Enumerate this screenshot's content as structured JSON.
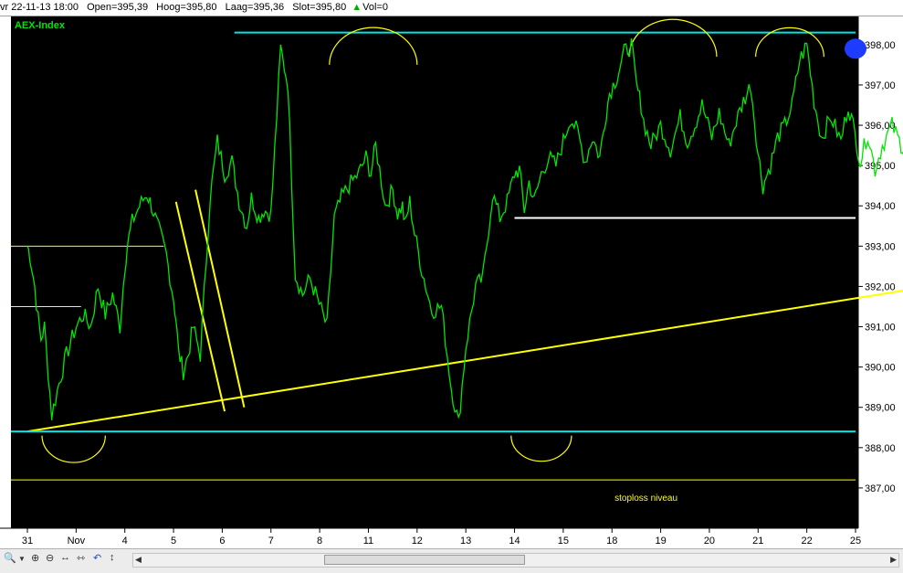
{
  "info": {
    "datetime": "vr 22-11-13 18:00",
    "open": "Open=395,39",
    "high": "Hoog=395,80",
    "low": "Laag=395,36",
    "close": "Slot=395,80",
    "vol_icon": "triangle-up-icon",
    "vol": "Vol=0"
  },
  "chart_data": {
    "type": "line",
    "title": "AEX-Index",
    "annotation": "stoploss niveau",
    "ylim": [
      386.0,
      398.7
    ],
    "y_ticks": [
      "398,00",
      "397,00",
      "396,00",
      "395,00",
      "394,00",
      "393,00",
      "392,00",
      "391,00",
      "390,00",
      "389,00",
      "388,00",
      "387,00"
    ],
    "x_tick_labels": [
      "31",
      "Nov",
      "4",
      "5",
      "6",
      "7",
      "8",
      "11",
      "12",
      "13",
      "14",
      "15",
      "18",
      "19",
      "20",
      "21",
      "22",
      "25"
    ],
    "series": [
      {
        "x": [
          0.0,
          0.05,
          0.15,
          0.22,
          0.28,
          0.35,
          0.5,
          0.65,
          0.8,
          1.0,
          1.15,
          1.3,
          1.45,
          1.6,
          1.75,
          1.9,
          2.0,
          2.05,
          2.15,
          2.3,
          2.45,
          2.55,
          2.7,
          2.85,
          3.0,
          3.05,
          3.1,
          3.2,
          3.3,
          3.4,
          3.55,
          3.75,
          3.9,
          4.05,
          4.2,
          4.35,
          4.5,
          4.6,
          4.75,
          4.85,
          5.0,
          5.2,
          5.35,
          5.5,
          5.65,
          5.8,
          5.95,
          6.15,
          6.3,
          6.45,
          6.6,
          6.8,
          6.95,
          7.05,
          7.15,
          7.35,
          7.5,
          7.6,
          7.7,
          7.75,
          7.85,
          7.95,
          8.1,
          8.3,
          8.5,
          8.7,
          8.85,
          9.0,
          9.2,
          9.35,
          9.55,
          9.7,
          9.85,
          10.0,
          10.1,
          10.2,
          10.3,
          10.4,
          10.55,
          10.7,
          10.85,
          11.0,
          11.15,
          11.3,
          11.45,
          11.6,
          11.75,
          11.85,
          11.95,
          12.1,
          12.25,
          12.4,
          12.5,
          12.6,
          12.65,
          12.8,
          13.0,
          13.2,
          13.4,
          13.55,
          13.7,
          13.85,
          14.05,
          14.2,
          14.4,
          14.55,
          14.7,
          14.85,
          15.0,
          15.1,
          15.25,
          15.4,
          15.55,
          15.7,
          15.85,
          16.0,
          16.15,
          16.3,
          16.5,
          16.7,
          16.85,
          16.95,
          17.1,
          17.25,
          17.4,
          17.55,
          17.75,
          17.9,
          18.0
        ],
        "values": [
          393.0,
          392.8,
          392.0,
          391.2,
          390.7,
          391.0,
          388.8,
          389.6,
          390.3,
          391.0,
          391.3,
          391.0,
          392.0,
          391.3,
          391.8,
          391.0,
          392.5,
          393.0,
          393.6,
          394.0,
          394.3,
          394.0,
          393.4,
          392.8,
          391.7,
          391.2,
          390.4,
          389.9,
          390.3,
          391.0,
          390.3,
          394.2,
          395.6,
          394.8,
          395.1,
          394.1,
          393.5,
          394.2,
          393.7,
          393.9,
          393.8,
          397.9,
          397.0,
          392.3,
          391.8,
          392.2,
          391.7,
          391.0,
          393.7,
          394.2,
          394.5,
          394.8,
          395.2,
          394.8,
          395.5,
          394.0,
          394.4,
          393.8,
          394.0,
          393.5,
          394.1,
          393.3,
          392.4,
          391.4,
          391.5,
          389.5,
          388.6,
          390.5,
          392.0,
          392.2,
          394.3,
          393.7,
          394.1,
          394.8,
          394.9,
          393.9,
          394.6,
          394.1,
          394.8,
          395.2,
          395.0,
          395.6,
          396.2,
          395.8,
          395.1,
          395.7,
          395.2,
          396.1,
          396.8,
          397.2,
          397.8,
          398.0,
          397.0,
          396.5,
          396.1,
          395.5,
          396.0,
          395.4,
          396.2,
          395.6,
          396.0,
          396.5,
          395.7,
          396.3,
          395.5,
          396.1,
          396.6,
          397.0,
          395.3,
          394.5,
          395.0,
          395.7,
          396.0,
          396.5,
          397.6,
          398.0,
          396.6,
          395.7,
          396.2,
          395.6,
          396.5,
          396.0,
          395.1,
          395.8,
          394.9,
          395.5,
          396.0,
          395.6,
          395.4
        ]
      }
    ],
    "annotations": [
      {
        "kind": "trendline",
        "color": "#ffff00",
        "points": [
          [
            0.0,
            388.4
          ],
          [
            18.0,
            391.9
          ]
        ]
      },
      {
        "kind": "trendline",
        "color": "#ffff00",
        "points": [
          [
            3.45,
            394.4
          ],
          [
            4.45,
            389.0
          ]
        ]
      },
      {
        "kind": "trendline",
        "color": "#ffff00",
        "points": [
          [
            3.05,
            394.1
          ],
          [
            4.05,
            388.9
          ]
        ]
      },
      {
        "kind": "hline",
        "color": "#00e5e5",
        "y": 398.3,
        "from": 4.25,
        "to": 18.0
      },
      {
        "kind": "hline",
        "color": "#00e5e5",
        "y": 388.4,
        "from": 0.0,
        "to": 18.0
      },
      {
        "kind": "hline",
        "color": "#ffffff",
        "y": 393.7,
        "from": 10.0,
        "to": 17.95
      },
      {
        "kind": "hline",
        "color": "#ffff00",
        "y": 393.0,
        "from": 0.0,
        "to": 2.8
      },
      {
        "kind": "hline",
        "color": "#ffff00",
        "y": 391.5,
        "from": 0.0,
        "to": 1.1
      },
      {
        "kind": "hline",
        "color": "#ffff00",
        "y": 387.2,
        "from": 0.0,
        "to": 18.0
      },
      {
        "kind": "arc",
        "color": "#ffff00",
        "cx": 7.1,
        "cy": 397.5,
        "r": 0.9,
        "dir": "up"
      },
      {
        "kind": "arc",
        "color": "#ffff00",
        "cx": 13.25,
        "cy": 397.7,
        "r": 0.9,
        "dir": "up"
      },
      {
        "kind": "arc",
        "color": "#ffff00",
        "cx": 15.65,
        "cy": 397.7,
        "r": 0.7,
        "dir": "up"
      },
      {
        "kind": "arc",
        "color": "#ffff00",
        "cx": 0.95,
        "cy": 388.3,
        "r": 0.65,
        "dir": "down"
      },
      {
        "kind": "arc",
        "color": "#ffff00",
        "cx": 10.55,
        "cy": 388.3,
        "r": 0.62,
        "dir": "down"
      },
      {
        "kind": "dot",
        "color": "#1e3cff",
        "x": 17.0,
        "y": 397.9
      }
    ]
  },
  "colors": {
    "chart_bg": "#000000",
    "series": "#00e600",
    "axis_text": "#000000",
    "title": "#00e600",
    "annotation_text": "#ffff00"
  },
  "toolbar": {
    "icons": [
      "zoom-icon",
      "dropdown-icon",
      "zoom-in-icon",
      "zoom-out-icon",
      "pan-horizontal-icon",
      "expand-icon",
      "undo-icon",
      "pan-vertical-icon"
    ],
    "scroll_position": 0.33
  }
}
